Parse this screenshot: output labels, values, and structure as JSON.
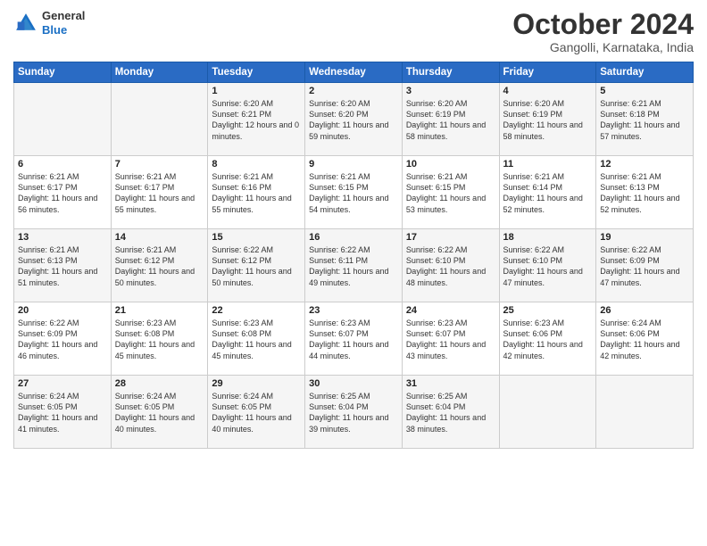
{
  "header": {
    "logo_general": "General",
    "logo_blue": "Blue",
    "month_title": "October 2024",
    "location": "Gangolli, Karnataka, India"
  },
  "weekdays": [
    "Sunday",
    "Monday",
    "Tuesday",
    "Wednesday",
    "Thursday",
    "Friday",
    "Saturday"
  ],
  "weeks": [
    [
      {
        "day": "",
        "sunrise": "",
        "sunset": "",
        "daylight": ""
      },
      {
        "day": "",
        "sunrise": "",
        "sunset": "",
        "daylight": ""
      },
      {
        "day": "1",
        "sunrise": "Sunrise: 6:20 AM",
        "sunset": "Sunset: 6:21 PM",
        "daylight": "Daylight: 12 hours and 0 minutes."
      },
      {
        "day": "2",
        "sunrise": "Sunrise: 6:20 AM",
        "sunset": "Sunset: 6:20 PM",
        "daylight": "Daylight: 11 hours and 59 minutes."
      },
      {
        "day": "3",
        "sunrise": "Sunrise: 6:20 AM",
        "sunset": "Sunset: 6:19 PM",
        "daylight": "Daylight: 11 hours and 58 minutes."
      },
      {
        "day": "4",
        "sunrise": "Sunrise: 6:20 AM",
        "sunset": "Sunset: 6:19 PM",
        "daylight": "Daylight: 11 hours and 58 minutes."
      },
      {
        "day": "5",
        "sunrise": "Sunrise: 6:21 AM",
        "sunset": "Sunset: 6:18 PM",
        "daylight": "Daylight: 11 hours and 57 minutes."
      }
    ],
    [
      {
        "day": "6",
        "sunrise": "Sunrise: 6:21 AM",
        "sunset": "Sunset: 6:17 PM",
        "daylight": "Daylight: 11 hours and 56 minutes."
      },
      {
        "day": "7",
        "sunrise": "Sunrise: 6:21 AM",
        "sunset": "Sunset: 6:17 PM",
        "daylight": "Daylight: 11 hours and 55 minutes."
      },
      {
        "day": "8",
        "sunrise": "Sunrise: 6:21 AM",
        "sunset": "Sunset: 6:16 PM",
        "daylight": "Daylight: 11 hours and 55 minutes."
      },
      {
        "day": "9",
        "sunrise": "Sunrise: 6:21 AM",
        "sunset": "Sunset: 6:15 PM",
        "daylight": "Daylight: 11 hours and 54 minutes."
      },
      {
        "day": "10",
        "sunrise": "Sunrise: 6:21 AM",
        "sunset": "Sunset: 6:15 PM",
        "daylight": "Daylight: 11 hours and 53 minutes."
      },
      {
        "day": "11",
        "sunrise": "Sunrise: 6:21 AM",
        "sunset": "Sunset: 6:14 PM",
        "daylight": "Daylight: 11 hours and 52 minutes."
      },
      {
        "day": "12",
        "sunrise": "Sunrise: 6:21 AM",
        "sunset": "Sunset: 6:13 PM",
        "daylight": "Daylight: 11 hours and 52 minutes."
      }
    ],
    [
      {
        "day": "13",
        "sunrise": "Sunrise: 6:21 AM",
        "sunset": "Sunset: 6:13 PM",
        "daylight": "Daylight: 11 hours and 51 minutes."
      },
      {
        "day": "14",
        "sunrise": "Sunrise: 6:21 AM",
        "sunset": "Sunset: 6:12 PM",
        "daylight": "Daylight: 11 hours and 50 minutes."
      },
      {
        "day": "15",
        "sunrise": "Sunrise: 6:22 AM",
        "sunset": "Sunset: 6:12 PM",
        "daylight": "Daylight: 11 hours and 50 minutes."
      },
      {
        "day": "16",
        "sunrise": "Sunrise: 6:22 AM",
        "sunset": "Sunset: 6:11 PM",
        "daylight": "Daylight: 11 hours and 49 minutes."
      },
      {
        "day": "17",
        "sunrise": "Sunrise: 6:22 AM",
        "sunset": "Sunset: 6:10 PM",
        "daylight": "Daylight: 11 hours and 48 minutes."
      },
      {
        "day": "18",
        "sunrise": "Sunrise: 6:22 AM",
        "sunset": "Sunset: 6:10 PM",
        "daylight": "Daylight: 11 hours and 47 minutes."
      },
      {
        "day": "19",
        "sunrise": "Sunrise: 6:22 AM",
        "sunset": "Sunset: 6:09 PM",
        "daylight": "Daylight: 11 hours and 47 minutes."
      }
    ],
    [
      {
        "day": "20",
        "sunrise": "Sunrise: 6:22 AM",
        "sunset": "Sunset: 6:09 PM",
        "daylight": "Daylight: 11 hours and 46 minutes."
      },
      {
        "day": "21",
        "sunrise": "Sunrise: 6:23 AM",
        "sunset": "Sunset: 6:08 PM",
        "daylight": "Daylight: 11 hours and 45 minutes."
      },
      {
        "day": "22",
        "sunrise": "Sunrise: 6:23 AM",
        "sunset": "Sunset: 6:08 PM",
        "daylight": "Daylight: 11 hours and 45 minutes."
      },
      {
        "day": "23",
        "sunrise": "Sunrise: 6:23 AM",
        "sunset": "Sunset: 6:07 PM",
        "daylight": "Daylight: 11 hours and 44 minutes."
      },
      {
        "day": "24",
        "sunrise": "Sunrise: 6:23 AM",
        "sunset": "Sunset: 6:07 PM",
        "daylight": "Daylight: 11 hours and 43 minutes."
      },
      {
        "day": "25",
        "sunrise": "Sunrise: 6:23 AM",
        "sunset": "Sunset: 6:06 PM",
        "daylight": "Daylight: 11 hours and 42 minutes."
      },
      {
        "day": "26",
        "sunrise": "Sunrise: 6:24 AM",
        "sunset": "Sunset: 6:06 PM",
        "daylight": "Daylight: 11 hours and 42 minutes."
      }
    ],
    [
      {
        "day": "27",
        "sunrise": "Sunrise: 6:24 AM",
        "sunset": "Sunset: 6:05 PM",
        "daylight": "Daylight: 11 hours and 41 minutes."
      },
      {
        "day": "28",
        "sunrise": "Sunrise: 6:24 AM",
        "sunset": "Sunset: 6:05 PM",
        "daylight": "Daylight: 11 hours and 40 minutes."
      },
      {
        "day": "29",
        "sunrise": "Sunrise: 6:24 AM",
        "sunset": "Sunset: 6:05 PM",
        "daylight": "Daylight: 11 hours and 40 minutes."
      },
      {
        "day": "30",
        "sunrise": "Sunrise: 6:25 AM",
        "sunset": "Sunset: 6:04 PM",
        "daylight": "Daylight: 11 hours and 39 minutes."
      },
      {
        "day": "31",
        "sunrise": "Sunrise: 6:25 AM",
        "sunset": "Sunset: 6:04 PM",
        "daylight": "Daylight: 11 hours and 38 minutes."
      },
      {
        "day": "",
        "sunrise": "",
        "sunset": "",
        "daylight": ""
      },
      {
        "day": "",
        "sunrise": "",
        "sunset": "",
        "daylight": ""
      }
    ]
  ]
}
